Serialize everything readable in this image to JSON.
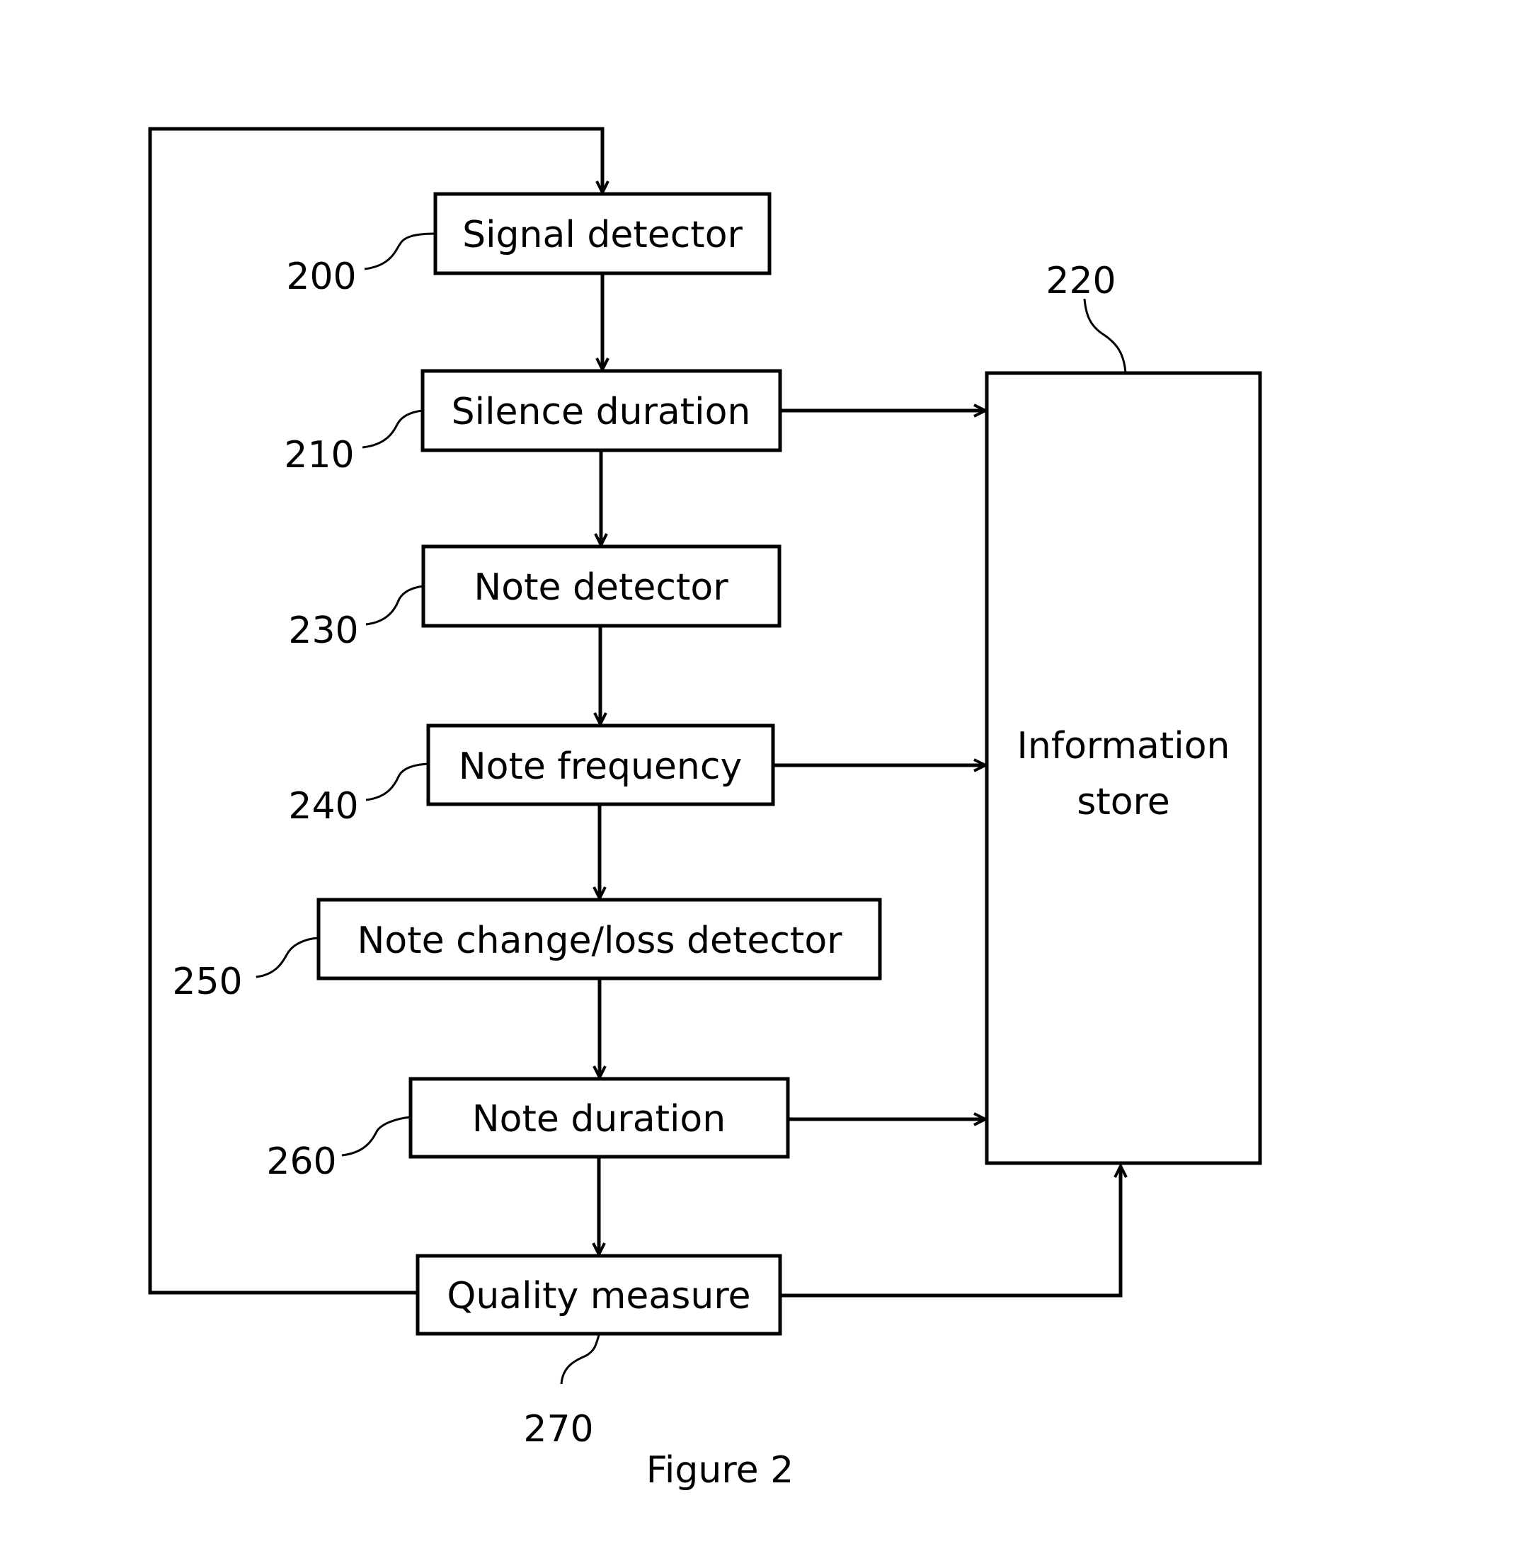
{
  "figure": {
    "caption": "Figure 2",
    "blocks": [
      {
        "id": "signal-detector",
        "label": "Signal detector",
        "ref": "200"
      },
      {
        "id": "silence-duration",
        "label": "Silence duration",
        "ref": "210"
      },
      {
        "id": "note-detector",
        "label": "Note detector",
        "ref": "230"
      },
      {
        "id": "note-frequency",
        "label": "Note frequency",
        "ref": "240"
      },
      {
        "id": "note-change-loss-detector",
        "label": "Note change/loss detector",
        "ref": "250"
      },
      {
        "id": "note-duration",
        "label": "Note duration",
        "ref": "260"
      },
      {
        "id": "quality-measure",
        "label": "Quality measure",
        "ref": "270"
      }
    ],
    "store": {
      "id": "information-store",
      "label_line1": "Information",
      "label_line2": "store",
      "ref": "220"
    },
    "connections": [
      {
        "from": "signal-detector",
        "to": "silence-duration"
      },
      {
        "from": "silence-duration",
        "to": "note-detector"
      },
      {
        "from": "note-detector",
        "to": "note-frequency"
      },
      {
        "from": "note-frequency",
        "to": "note-change-loss-detector"
      },
      {
        "from": "note-change-loss-detector",
        "to": "note-duration"
      },
      {
        "from": "note-duration",
        "to": "quality-measure"
      },
      {
        "from": "silence-duration",
        "to": "information-store"
      },
      {
        "from": "note-frequency",
        "to": "information-store"
      },
      {
        "from": "note-duration",
        "to": "information-store"
      },
      {
        "from": "quality-measure",
        "to": "information-store"
      },
      {
        "from": "quality-measure",
        "to": "signal-detector",
        "type": "feedback-loop"
      }
    ]
  }
}
